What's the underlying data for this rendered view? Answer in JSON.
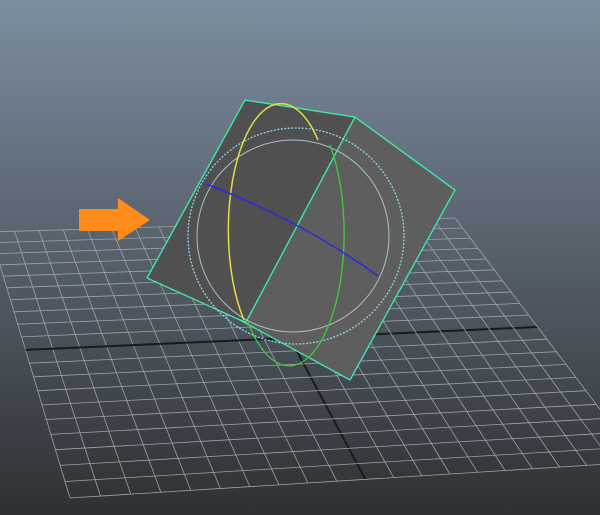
{
  "viewport": {
    "name": "perspective-viewport",
    "colors": {
      "background_top": "#7c8ea0",
      "background_bottom": "#2e3033",
      "grid_line": "#9ea3a8",
      "grid_axis": "#1a1a1a",
      "cube_face_dark": "#505050",
      "cube_face_light": "#5e5e5e",
      "selection_highlight": "#3ee6a8",
      "manipulator_outer_ring": "#8fd3e6",
      "manipulator_x_ring": "#e0e040",
      "manipulator_y_ring": "#3ccf3c",
      "manipulator_z_ring": "#2a2adf",
      "arrow": "#ff8c1a"
    },
    "objects": [
      {
        "name": "cube",
        "type": "polygon-cube",
        "selected": true
      },
      {
        "name": "rotate-manipulator",
        "type": "rotate-tool"
      },
      {
        "name": "ground-grid",
        "type": "grid"
      },
      {
        "name": "annotation-arrow",
        "type": "arrow-icon",
        "direction": "right"
      }
    ]
  }
}
